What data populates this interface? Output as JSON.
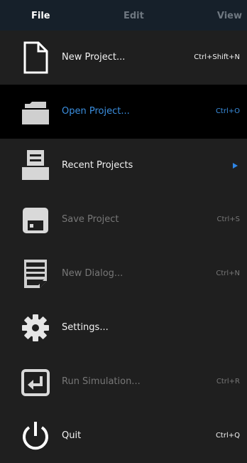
{
  "menubar": {
    "file": "File",
    "edit": "Edit",
    "view": "View"
  },
  "colors": {
    "menubar_bg": "#16202a",
    "menu_bg": "#1f1f1f",
    "highlight_bg": "#000000",
    "highlight_text": "#3b8fe0",
    "submenu_arrow": "#2f86e6",
    "enabled_text": "#f2f2f2",
    "disabled_text": "#777777"
  },
  "menu_items": [
    {
      "icon": "new-document-icon",
      "label": "New Project...",
      "shortcut": "Ctrl+Shift+N",
      "state": "enabled"
    },
    {
      "icon": "open-folder-icon",
      "label": "Open Project...",
      "shortcut": "Ctrl+O",
      "state": "highlighted"
    },
    {
      "icon": "recent-projects-icon",
      "label": "Recent Projects",
      "shortcut": "",
      "state": "enabled",
      "submenu": true
    },
    {
      "icon": "save-icon",
      "label": "Save Project",
      "shortcut": "Ctrl+S",
      "state": "disabled"
    },
    {
      "icon": "new-dialog-icon",
      "label": "New Dialog...",
      "shortcut": "Ctrl+N",
      "state": "disabled"
    },
    {
      "icon": "gear-icon",
      "label": "Settings...",
      "shortcut": "",
      "state": "enabled"
    },
    {
      "icon": "run-simulation-icon",
      "label": "Run Simulation...",
      "shortcut": "Ctrl+R",
      "state": "disabled"
    },
    {
      "icon": "power-icon",
      "label": "Quit",
      "shortcut": "Ctrl+Q",
      "state": "enabled"
    }
  ]
}
